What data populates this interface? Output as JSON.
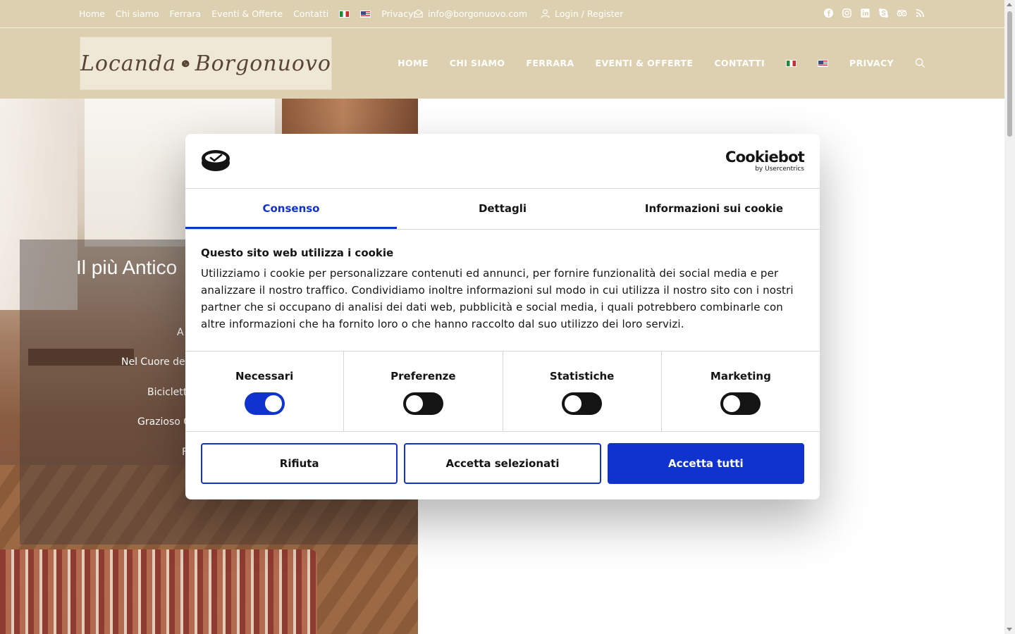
{
  "topbar": {
    "links": [
      "Home",
      "Chi siamo",
      "Ferrara",
      "Eventi & Offerte",
      "Contatti"
    ],
    "privacy": "Privacy",
    "email": "info@borgonuovo.com",
    "login": "Login / Register",
    "social_icons": [
      "facebook-icon",
      "instagram-icon",
      "linkedin-icon",
      "skype-icon",
      "tripadvisor-icon",
      "rss-icon"
    ]
  },
  "header": {
    "logo_text_left": "Locanda",
    "logo_text_right": "Borgonuovo",
    "nav": [
      "HOME",
      "CHI SIAMO",
      "FERRARA",
      "EVENTI & OFFERTE",
      "CONTATTI"
    ],
    "nav_privacy": "PRIVACY"
  },
  "hero": {
    "title": "Il più Antico",
    "features": [
      "A",
      "Nel Cuore del",
      "Biciclett",
      "Grazioso G",
      "F"
    ]
  },
  "cookie_dialog": {
    "brand_name": "Cookiebot",
    "brand_sub": "by Usercentrics",
    "tabs": [
      "Consenso",
      "Dettagli",
      "Informazioni sui cookie"
    ],
    "active_tab": "Consenso",
    "title": "Questo sito web utilizza i cookie",
    "text": "Utilizziamo i cookie per personalizzare contenuti ed annunci, per fornire funzionalità dei social media e per analizzare il nostro traffico. Condividiamo inoltre informazioni sul modo in cui utilizza il nostro sito con i nostri partner che si occupano di analisi dei dati web, pubblicità e social media, i quali potrebbero combinarle con altre informazioni che ha fornito loro o che hanno raccolto dal suo utilizzo dei loro servizi.",
    "toggles": [
      {
        "label": "Necessari",
        "checked": true
      },
      {
        "label": "Preferenze",
        "checked": false
      },
      {
        "label": "Statistiche",
        "checked": false
      },
      {
        "label": "Marketing",
        "checked": false
      }
    ],
    "buttons": {
      "reject": "Rifiuta",
      "accept_selected": "Accetta selezionati",
      "accept_all": "Accetta tutti"
    }
  },
  "colors": {
    "header_bg": "#ddd0b0",
    "accent": "#1032cf"
  }
}
